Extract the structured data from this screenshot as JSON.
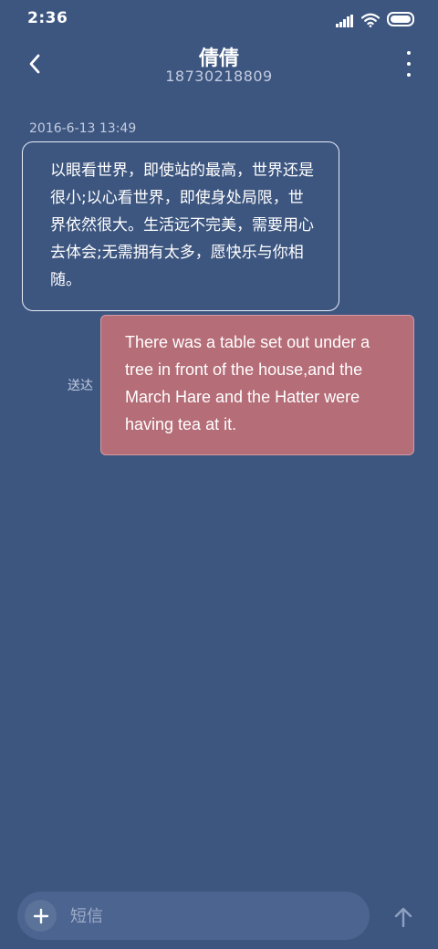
{
  "status_bar": {
    "time": "2:36",
    "icons": [
      "signal-icon",
      "wifi-icon",
      "battery-icon"
    ]
  },
  "header": {
    "back_icon": "chevron-left-icon",
    "contact_name": "倩倩",
    "phone_number": "18730218809",
    "more_icon": "more-vertical-icon"
  },
  "conversation": {
    "timestamp": "2016-6-13 13:49",
    "received_message": "以眼看世界，即使站的最高，世界还是很小;以心看世界，即使身处局限，世界依然很大。生活远不完美，需要用心去体会;无需拥有太多，愿快乐与你相随。",
    "sent_status": "送达",
    "sent_message": "There was a table set out under a tree in front of the house,and the March Hare and the Hatter were having tea at it."
  },
  "compose": {
    "add_icon": "plus-icon",
    "placeholder": "短信",
    "send_icon": "arrow-up-icon"
  },
  "colors": {
    "background": "#3d5680",
    "sent_bubble": "#b56d78",
    "received_border": "#e8ecf5",
    "muted_text": "#c3cbe0",
    "compose_bar": "#4b6490"
  }
}
